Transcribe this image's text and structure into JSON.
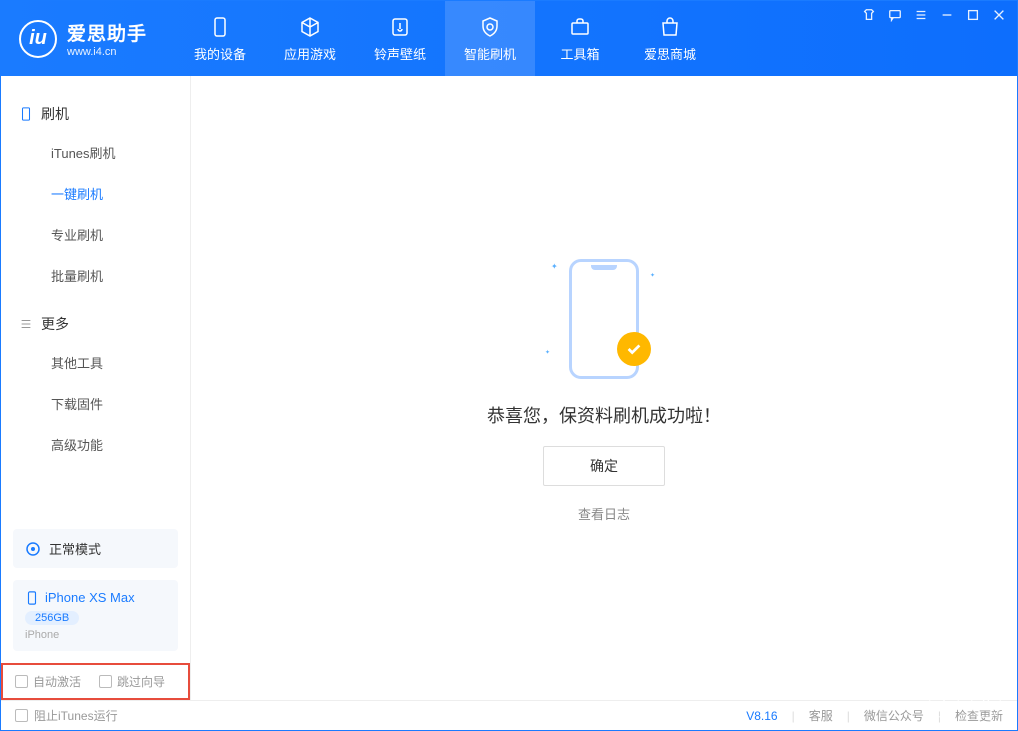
{
  "app": {
    "title": "爱思助手",
    "subtitle": "www.i4.cn"
  },
  "nav": {
    "items": [
      {
        "label": "我的设备"
      },
      {
        "label": "应用游戏"
      },
      {
        "label": "铃声壁纸"
      },
      {
        "label": "智能刷机"
      },
      {
        "label": "工具箱"
      },
      {
        "label": "爱思商城"
      }
    ]
  },
  "sidebar": {
    "section1": {
      "title": "刷机",
      "items": [
        "iTunes刷机",
        "一键刷机",
        "专业刷机",
        "批量刷机"
      ]
    },
    "section2": {
      "title": "更多",
      "items": [
        "其他工具",
        "下载固件",
        "高级功能"
      ]
    },
    "mode": "正常模式",
    "device": {
      "name": "iPhone XS Max",
      "capacity": "256GB",
      "type": "iPhone"
    },
    "checkboxes": {
      "auto_activate": "自动激活",
      "skip_guide": "跳过向导"
    }
  },
  "main": {
    "success_text": "恭喜您，保资料刷机成功啦！",
    "ok_button": "确定",
    "log_link": "查看日志"
  },
  "footer": {
    "block_itunes": "阻止iTunes运行",
    "version": "V8.16",
    "links": [
      "客服",
      "微信公众号",
      "检查更新"
    ]
  }
}
